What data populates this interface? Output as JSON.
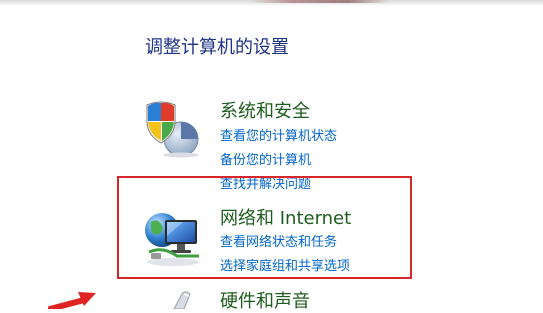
{
  "page_title": "调整计算机的设置",
  "categories": [
    {
      "title": "系统和安全",
      "icon": "shield-security-icon",
      "tasks": [
        "查看您的计算机状态",
        "备份您的计算机",
        "查找并解决问题"
      ]
    },
    {
      "title": "网络和 Internet",
      "icon": "network-globe-icon",
      "tasks": [
        "查看网络状态和任务",
        "选择家庭组和共享选项"
      ]
    },
    {
      "title": "硬件和声音",
      "icon": "hardware-sound-icon",
      "tasks": []
    }
  ],
  "annotation": {
    "highlight_color": "#d7262a"
  },
  "colors": {
    "title": "#1e3287",
    "category": "#1e5c1e",
    "link": "#0066cc"
  }
}
